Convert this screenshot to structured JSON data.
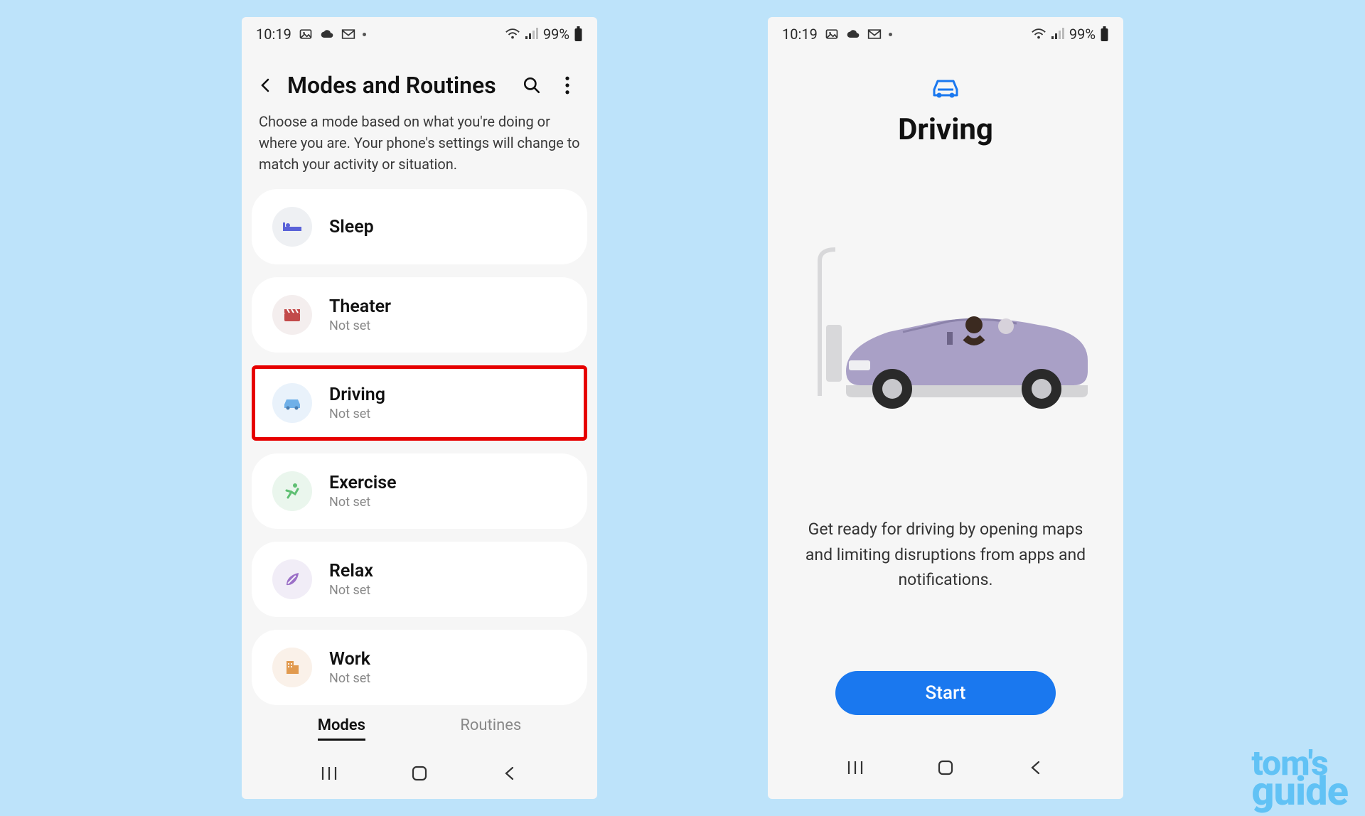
{
  "watermark": {
    "line1": "tom's",
    "line2": "guide"
  },
  "statusbar": {
    "time": "10:19",
    "battery": "99%"
  },
  "phone1": {
    "header_title": "Modes and Routines",
    "subtitle": "Choose a mode based on what you're doing or where you are. Your phone's settings will change to match your activity or situation.",
    "modes": [
      {
        "name": "Sleep",
        "sub": ""
      },
      {
        "name": "Theater",
        "sub": "Not set"
      },
      {
        "name": "Driving",
        "sub": "Not set"
      },
      {
        "name": "Exercise",
        "sub": "Not set"
      },
      {
        "name": "Relax",
        "sub": "Not set"
      },
      {
        "name": "Work",
        "sub": "Not set"
      }
    ],
    "tabs": {
      "modes": "Modes",
      "routines": "Routines"
    }
  },
  "phone2": {
    "title": "Driving",
    "description": "Get ready for driving by opening maps and limiting disruptions from apps and notifications.",
    "start_label": "Start"
  }
}
